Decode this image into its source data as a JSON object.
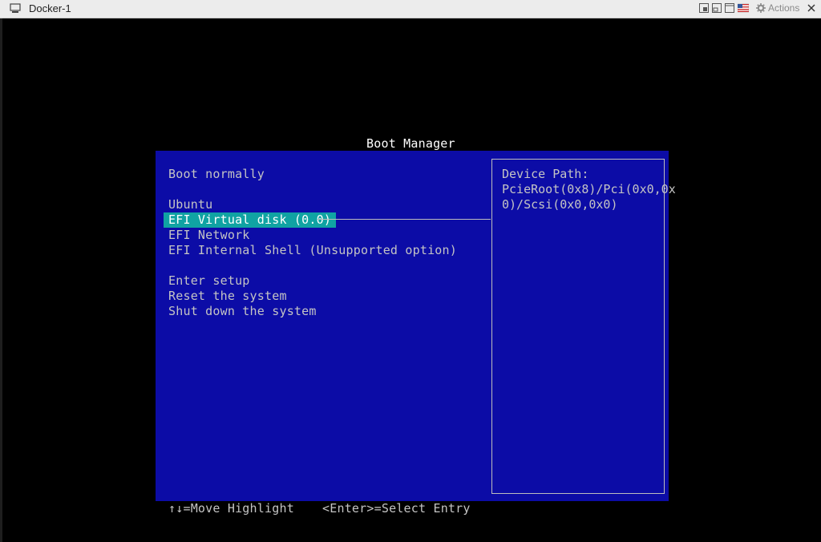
{
  "window": {
    "title": "Docker-1",
    "actions_label": "Actions",
    "icons": {
      "vm": "monitor-icon",
      "fit": "fit-window-icon",
      "restore": "restore-window-icon",
      "full": "fullscreen-icon",
      "keyboard": "us-flag-keyboard-icon",
      "actions": "gear-icon",
      "close": "close-icon"
    }
  },
  "boot_manager": {
    "title": "Boot Manager",
    "menu": [
      {
        "label": "Boot normally",
        "selected": false
      },
      {
        "label": "Ubuntu",
        "selected": false
      },
      {
        "label": "EFI Virtual disk (0.0)",
        "selected": true
      },
      {
        "label": "EFI Network",
        "selected": false
      },
      {
        "label": "EFI Internal Shell (Unsupported option)",
        "selected": false
      },
      {
        "label": "Enter setup",
        "selected": false
      },
      {
        "label": "Reset the system",
        "selected": false
      },
      {
        "label": "Shut down the system",
        "selected": false
      }
    ],
    "help": {
      "heading": "Device Path:",
      "line1": "PcieRoot(0x8)/Pci(0x0,0x",
      "line2": "0)/Scsi(0x0,0x0)"
    },
    "footer": {
      "move": "↑↓=Move Highlight",
      "enter": "<Enter>=Select Entry"
    }
  },
  "colors": {
    "panel_bg": "#0c0ca6",
    "highlight_bg": "#10a3a3",
    "text": "#c4c4c4",
    "title_text": "#ffffff"
  }
}
